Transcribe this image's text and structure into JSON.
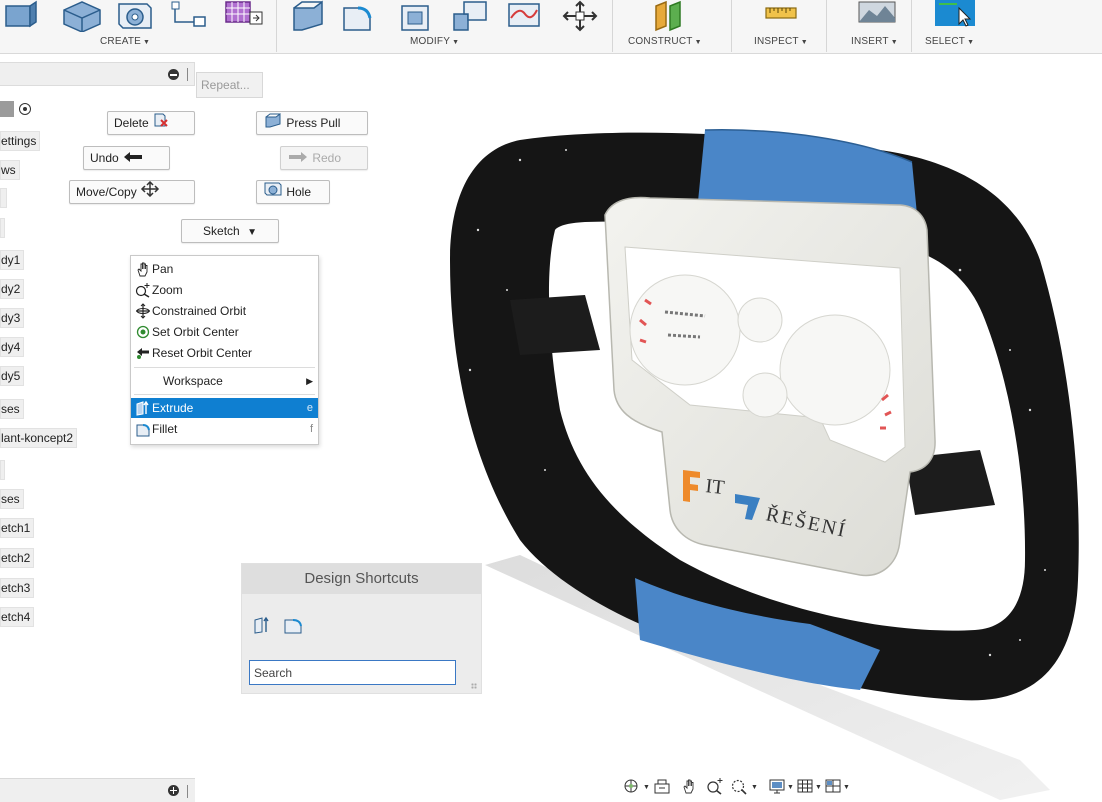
{
  "ribbon": {
    "groups": [
      {
        "label": "CREATE",
        "caret": "▼"
      },
      {
        "label": "MODIFY",
        "caret": "▼"
      },
      {
        "label": "CONSTRUCT",
        "caret": "▼"
      },
      {
        "label": "INSPECT",
        "caret": "▼"
      },
      {
        "label": "INSERT",
        "caret": "▼"
      },
      {
        "label": "SELECT",
        "caret": "▼"
      }
    ],
    "active_color": "#1b8ad1"
  },
  "browser": {
    "items": [
      "ettings",
      "ws",
      "",
      "",
      "dy1",
      "dy2",
      "dy3",
      "dy4",
      "dy5",
      "ses",
      "lant-koncept2",
      "",
      "ses",
      "etch1",
      "etch2",
      "etch3",
      "etch4"
    ]
  },
  "marking_menu": {
    "repeat_label": "Repeat...",
    "delete_label": "Delete",
    "press_pull_label": "Press Pull",
    "undo_label": "Undo",
    "redo_label": "Redo",
    "move_copy_label": "Move/Copy",
    "hole_label": "Hole",
    "sketch_label": "Sketch",
    "context_menu": {
      "items": [
        {
          "label": "Pan",
          "icon": "hand-icon",
          "key": ""
        },
        {
          "label": "Zoom",
          "icon": "zoom-icon",
          "key": ""
        },
        {
          "label": "Constrained Orbit",
          "icon": "orbit-icon",
          "key": ""
        },
        {
          "label": "Set Orbit Center",
          "icon": "target-icon",
          "key": ""
        },
        {
          "label": "Reset Orbit Center",
          "icon": "reset-arrow-icon",
          "key": ""
        },
        {
          "label": "Workspace",
          "icon": "",
          "key": "▶"
        },
        {
          "label": "Extrude",
          "icon": "extrude-icon",
          "key": "e",
          "selected": true
        },
        {
          "label": "Fillet",
          "icon": "fillet-icon",
          "key": "f"
        }
      ],
      "selected_color": "#0f7fd1"
    }
  },
  "design_shortcuts": {
    "title": "Design Shortcuts",
    "search_value": "Search"
  },
  "model": {
    "logo_text_1": "IT",
    "logo_text_2": "ŘEŠENÍ",
    "rim_color": "#1a1a1a",
    "accent_color": "#4a86c8"
  },
  "navbar": {
    "icons": [
      "orbit-icon",
      "look-at-icon",
      "pan-icon",
      "zoom-icon",
      "fit-icon",
      "display-settings-icon",
      "grid-icon",
      "viewports-icon"
    ]
  }
}
